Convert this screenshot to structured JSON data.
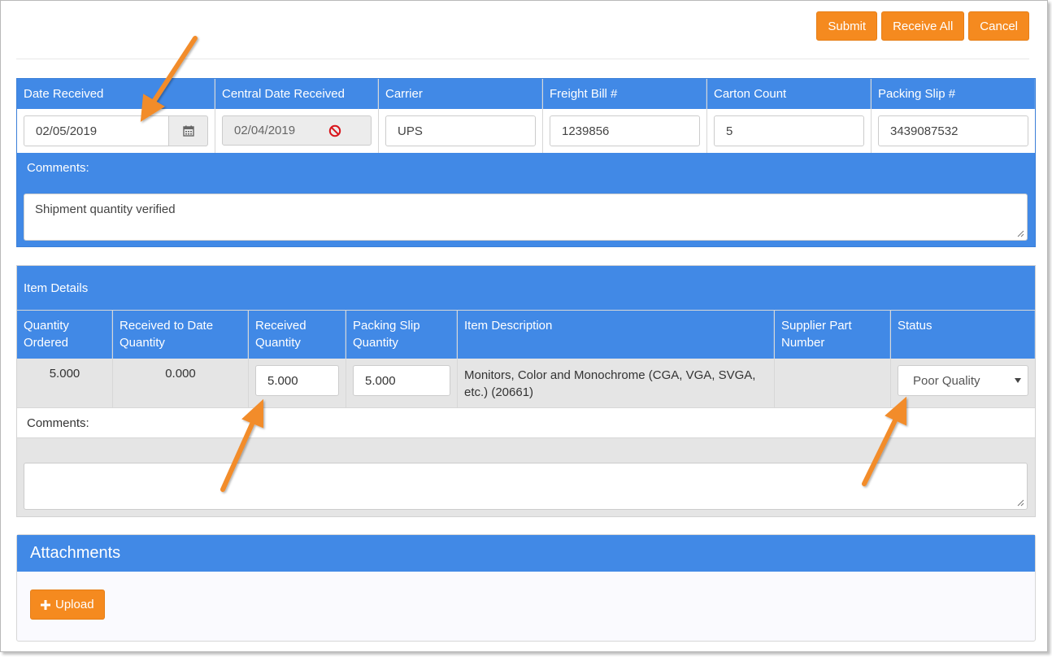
{
  "toolbar": {
    "submit_label": "Submit",
    "receive_all_label": "Receive All",
    "cancel_label": "Cancel"
  },
  "shipment": {
    "columns": [
      {
        "label": "Date Received",
        "value": "02/05/2019"
      },
      {
        "label": "Central Date Received",
        "value": "02/04/2019"
      },
      {
        "label": "Carrier",
        "value": "UPS"
      },
      {
        "label": "Freight Bill #",
        "value": "1239856"
      },
      {
        "label": "Carton Count",
        "value": "5"
      },
      {
        "label": "Packing Slip #",
        "value": "3439087532"
      }
    ],
    "comments_label": "Comments:",
    "comments_value": "Shipment quantity verified"
  },
  "item_details": {
    "title": "Item Details",
    "headers": [
      "Quantity Ordered",
      "Received to Date Quantity",
      "Received Quantity",
      "Packing Slip Quantity",
      "Item Description",
      "Supplier Part Number",
      "Status"
    ],
    "row": {
      "quantity_ordered": "5.000",
      "received_to_date": "0.000",
      "received_quantity": "5.000",
      "packing_slip_quantity": "5.000",
      "item_description": "Monitors, Color and Monochrome (CGA, VGA, SVGA, etc.) (20661)",
      "supplier_part_number": "",
      "status": "Poor Quality"
    },
    "comments_label": "Comments:",
    "comments_value": ""
  },
  "attachments": {
    "title": "Attachments",
    "upload_label": "Upload"
  },
  "colors": {
    "accent_blue": "#4189e6",
    "button_orange": "#f58a1f",
    "arrow_orange": "#f28c2c",
    "disabled_red": "#d9161c"
  }
}
